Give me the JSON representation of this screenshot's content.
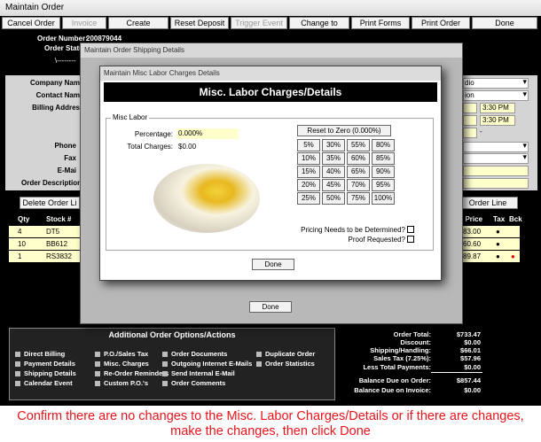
{
  "window": {
    "title": "Maintain  Order"
  },
  "toolbar": {
    "cancel": "Cancel Order",
    "invoice": "Invoice",
    "create_customer": "Create Customer",
    "reset_deposit": "Reset Deposit",
    "trigger_event": "Trigger Event",
    "change_quote": "Change to Quote",
    "print_forms": "Print Forms",
    "print_order": "Print Order",
    "done": "Done"
  },
  "order": {
    "number_label": "Order Number:",
    "number": "200879044",
    "status_label": "Order Status",
    "dash": "\\--------"
  },
  "form_labels": {
    "company": "Company Nam",
    "contact": "Contact Nam",
    "billing": "Billing Addres",
    "phone": "Phone",
    "fax": "Fax",
    "email": "E-Mai",
    "order_desc": "Order Description"
  },
  "right_fields": {
    "v1": "dio",
    "v2": "ion",
    "t1": "3:30 PM",
    "t2": "3:30 PM",
    "dash": "-"
  },
  "line_buttons": {
    "delete": "Delete Order Li",
    "add": "Order Line"
  },
  "grid": {
    "headers": {
      "qty": "Qty",
      "stock": "Stock #",
      "price": "l Price",
      "tax": "Tax",
      "bck": "Bck"
    },
    "rows": [
      {
        "qty": "4",
        "stock": "DT5",
        "price": "83.00"
      },
      {
        "qty": "10",
        "stock": "BB612",
        "price": "60.60"
      },
      {
        "qty": "1",
        "stock": "RS3832",
        "price": "89.87"
      }
    ]
  },
  "shipping_dialog": {
    "title": "Maintain Order Shipping Details",
    "done": "Done"
  },
  "labor_dialog": {
    "title": "Maintain Misc Labor Charges Details",
    "heading": "Misc. Labor Charges/Details",
    "group": "Misc Labor",
    "percentage_label": "Percentage:",
    "percentage": "0.000%",
    "total_label": "Total Charges:",
    "total": "$0.00",
    "reset": "Reset to Zero (0.000%)",
    "pcts": [
      "5%",
      "30%",
      "55%",
      "80%",
      "10%",
      "35%",
      "60%",
      "85%",
      "15%",
      "40%",
      "65%",
      "90%",
      "20%",
      "45%",
      "70%",
      "95%",
      "25%",
      "50%",
      "75%",
      "100%"
    ],
    "pricing_q": "Pricing Needs to be Determined?",
    "proof_q": "Proof Requested?",
    "done": "Done"
  },
  "options": {
    "heading": "Additional Order Options/Actions",
    "items": [
      "Direct Billing",
      "P.O./Sales Tax",
      "Order Documents",
      "Duplicate Order",
      "Payment Details",
      "Misc. Charges",
      "Outgoing Internet E-Mails",
      "Order Statistics",
      "Shipping Details",
      "Re-Order Reminders",
      "Send Internal E-Mail",
      "Calendar Event",
      "Custom P.O.'s",
      "Order Comments"
    ]
  },
  "totals": [
    {
      "label": "Order Total:",
      "value": "$733.47"
    },
    {
      "label": "Discount:",
      "value": "$0.00"
    },
    {
      "label": "Shipping/Handling:",
      "value": "$66.01"
    },
    {
      "label": "Sales Tax (7.25%):",
      "value": "$57.96"
    },
    {
      "label": "Less Total Payments:",
      "value": "$0.00"
    },
    {
      "label": "Balance Due on Order:",
      "value": "$857.44"
    },
    {
      "label": "Balance Due on Invoice:",
      "value": "$0.00"
    }
  ],
  "instruction": "Confirm there are no changes to the Misc. Labor Charges/Details or if there are changes, make the changes, then click Done",
  "colors": {
    "instruction": "#e8141c",
    "highlight": "#ffffcc",
    "bck_dot": "#e00000"
  }
}
